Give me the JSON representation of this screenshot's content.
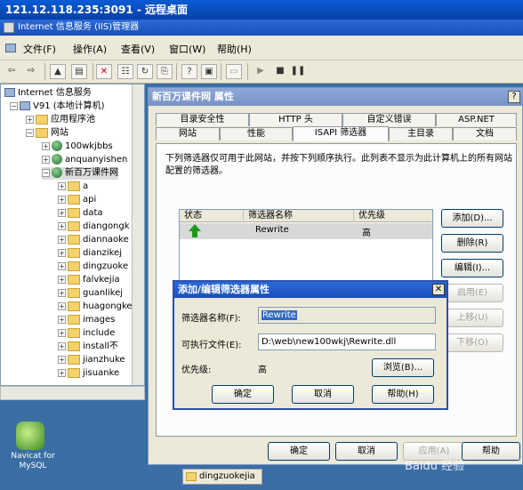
{
  "remote": {
    "title": "121.12.118.235:3091 - 远程桌面"
  },
  "iis": {
    "title": "Internet 信息服务 (IIS)管理器",
    "menu": [
      "文件(F)",
      "操作(A)",
      "查看(V)",
      "窗口(W)",
      "帮助(H)"
    ]
  },
  "tree": {
    "root": "Internet 信息服务",
    "computer": "V91 (本地计算机)",
    "app_pool": "应用程序池",
    "sites": "网站",
    "items": [
      "100wkjbbs",
      "anquanyishen",
      "新百万课件网",
      "a",
      "api",
      "data",
      "diangongk",
      "diannaoke",
      "dianzikej",
      "dingzuoke",
      "falvkejia",
      "guanlikej",
      "huagongke",
      "images",
      "include",
      "install不",
      "jianzhuke",
      "jisuanke"
    ]
  },
  "desktop": {
    "navicat": "Navicat for MySQL"
  },
  "props": {
    "title": "新百万课件网 属性",
    "help": "?",
    "tabs_row1": [
      "目录安全性",
      "HTTP 头",
      "自定义错误",
      "ASP.NET"
    ],
    "tabs_row2": [
      "网站",
      "性能",
      "ISAPI 筛选器",
      "主目录",
      "文档"
    ],
    "description": "下列筛选器仅可用于此网站，并按下列顺序执行。此列表不显示为此计算机上的所有网站配置的筛选器。",
    "columns": [
      "状态",
      "筛选器名称",
      "优先级"
    ],
    "row": {
      "name": "Rewrite",
      "priority": "高"
    },
    "side_buttons": [
      "添加(D)...",
      "删除(R)",
      "编辑(I)...",
      "启用(E)",
      "上移(U)",
      "下移(O)"
    ],
    "footer_buttons": [
      "确定",
      "取消",
      "应用(A)",
      "帮助"
    ]
  },
  "sub": {
    "title": "添加/编辑筛选器属性",
    "close": "✕",
    "name_label": "筛选器名称(F):",
    "name_value": "Rewrite",
    "exe_label": "可执行文件(E):",
    "exe_value": "D:\\web\\new100wkj\\Rewrite.dll",
    "priority_label": "优先级:",
    "priority_value": "高",
    "browse": "浏览(B)...",
    "ok": "确定",
    "cancel": "取消",
    "help": "帮助(H)"
  },
  "taskbar": {
    "item": "dingzuokejia"
  },
  "watermark": "Baidu 经验"
}
